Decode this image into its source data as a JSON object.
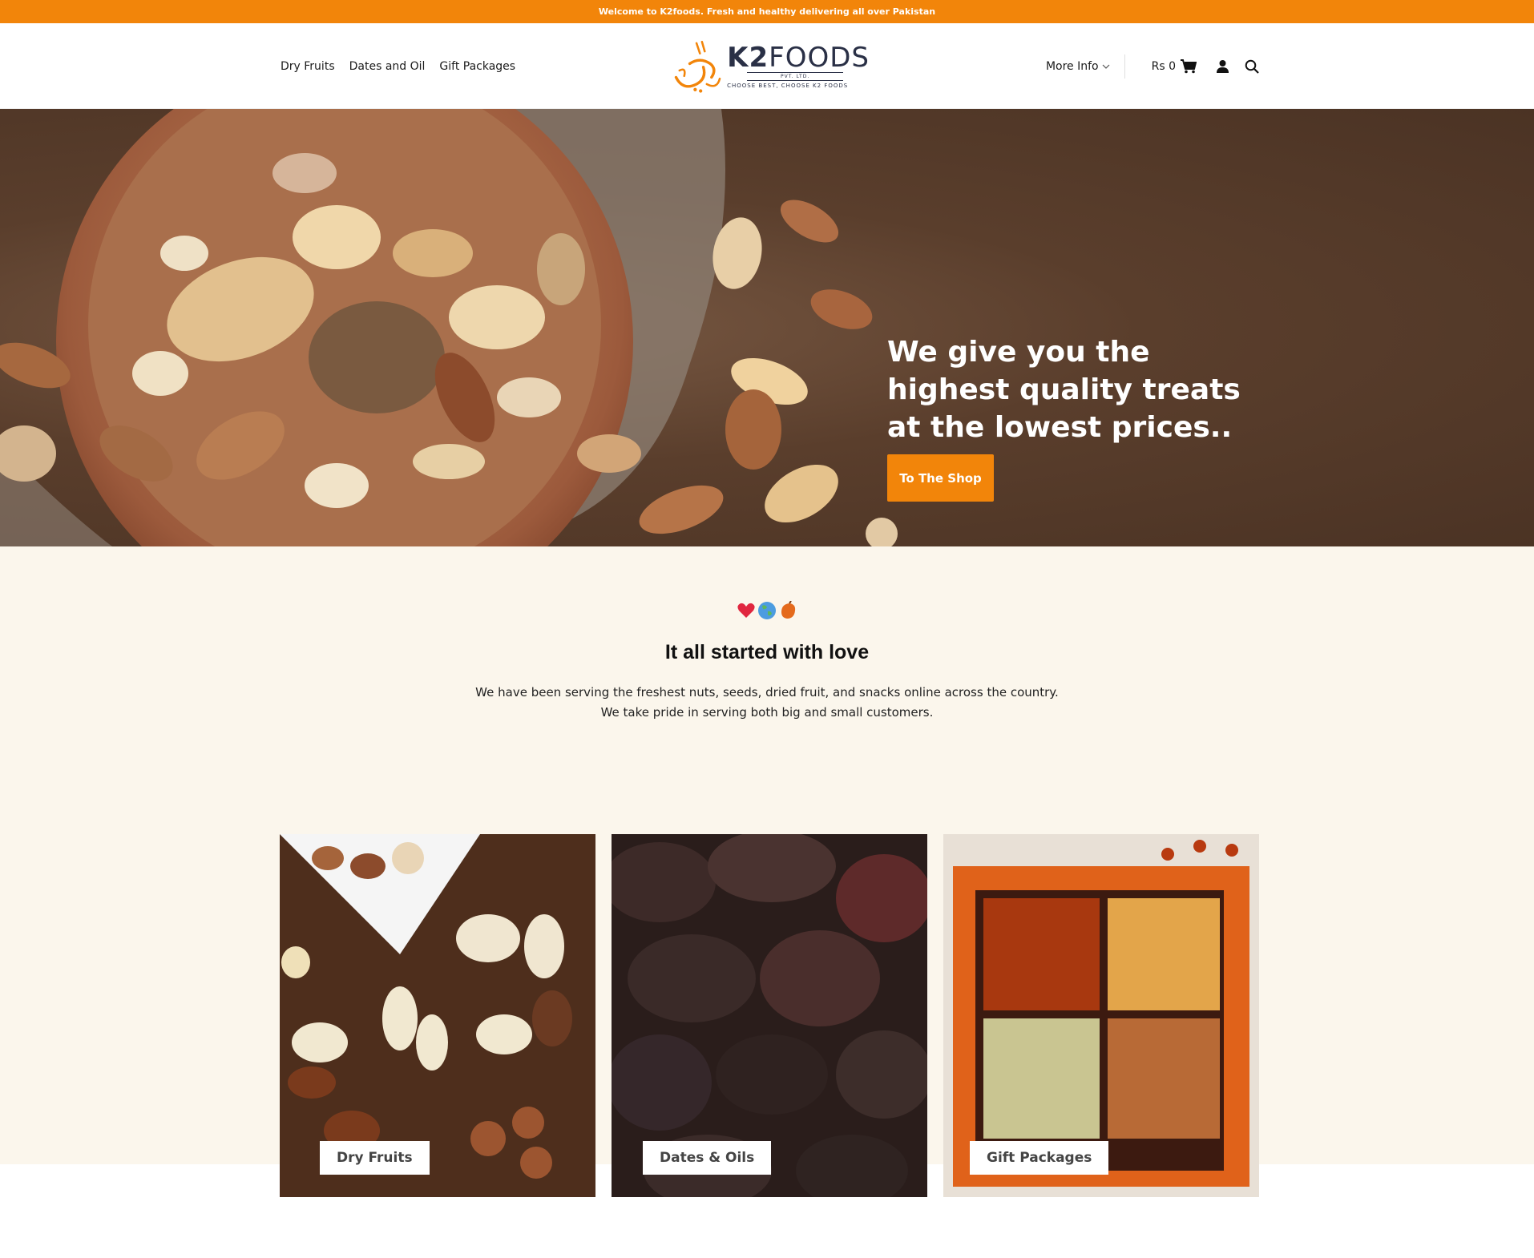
{
  "announcement": "Welcome to K2foods. Fresh and healthy delivering all over Pakistan",
  "nav": {
    "left": [
      "Dry Fruits",
      "Dates and Oil",
      "Gift Packages"
    ],
    "more_info": "More Info",
    "cart_amount": "Rs 0"
  },
  "logo": {
    "brand_bold": "K2",
    "brand_rest": "FOODS",
    "pvt": "PVT. LTD.",
    "tagline": "CHOOSE BEST, CHOOSE K2 FOODS"
  },
  "hero": {
    "headline": "We give you the highest quality treats at the lowest prices..",
    "button": "To The Shop"
  },
  "love": {
    "title": "It all started with love",
    "line1": "We have been serving the freshest nuts, seeds, dried fruit, and snacks online across the country.",
    "line2": "We take pride in serving both big and small customers."
  },
  "categories": [
    {
      "label": "Dry Fruits"
    },
    {
      "label": "Dates & Oils"
    },
    {
      "label": "Gift Packages"
    }
  ],
  "colors": {
    "accent": "#f2850a",
    "cream": "#fbf6ec",
    "brand_navy": "#2a3046"
  }
}
